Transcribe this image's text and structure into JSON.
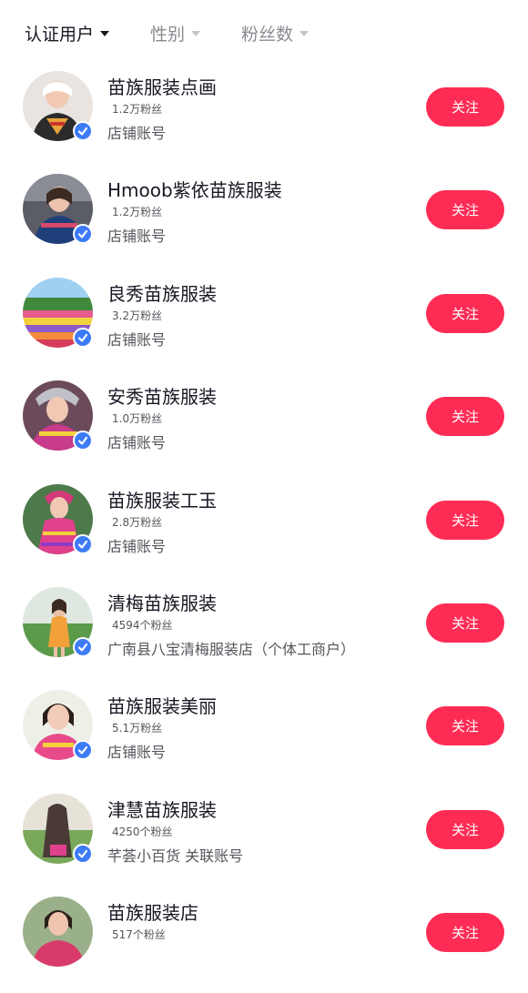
{
  "filters": [
    {
      "label": "认证用户",
      "active": true
    },
    {
      "label": "性别",
      "active": false
    },
    {
      "label": "粉丝数",
      "active": false
    }
  ],
  "colors": {
    "accent": "#fe2c55",
    "verified": "#3d7bf7",
    "text_primary": "#161823",
    "text_secondary": "#55565c"
  },
  "follow_label": "关注",
  "users": [
    {
      "name": "苗族服装点画",
      "fans": "1.2万粉丝",
      "subtitle": "店铺账号",
      "verified": true,
      "avatar_icon": "woman-portrait-avatar"
    },
    {
      "name": "Hmoob紫依苗族服装",
      "fans": "1.2万粉丝",
      "subtitle": "店铺账号",
      "verified": true,
      "avatar_icon": "woman-portrait-avatar"
    },
    {
      "name": "良秀苗族服装",
      "fans": "3.2万粉丝",
      "subtitle": "店铺账号",
      "verified": true,
      "avatar_icon": "flower-field-avatar"
    },
    {
      "name": "安秀苗族服装",
      "fans": "1.0万粉丝",
      "subtitle": "店铺账号",
      "verified": true,
      "avatar_icon": "woman-portrait-avatar"
    },
    {
      "name": "苗族服装工玉",
      "fans": "2.8万粉丝",
      "subtitle": "店铺账号",
      "verified": true,
      "avatar_icon": "woman-costume-avatar"
    },
    {
      "name": "清梅苗族服装",
      "fans": "4594个粉丝",
      "subtitle": "广南县八宝清梅服装店（个体工商户）",
      "verified": true,
      "avatar_icon": "woman-outdoor-avatar"
    },
    {
      "name": "苗族服装美丽",
      "fans": "5.1万粉丝",
      "subtitle": "店铺账号",
      "verified": true,
      "avatar_icon": "woman-portrait-avatar"
    },
    {
      "name": "津慧苗族服装",
      "fans": "4250个粉丝",
      "subtitle": "芊荟小百货 关联账号",
      "verified": true,
      "avatar_icon": "woman-outdoor-avatar"
    },
    {
      "name": "苗族服装店",
      "fans": "517个粉丝",
      "subtitle": "",
      "verified": false,
      "avatar_icon": "woman-portrait-avatar"
    }
  ]
}
